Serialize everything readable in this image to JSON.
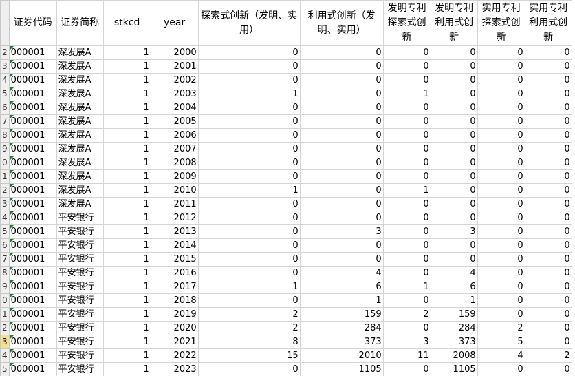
{
  "headers": [
    "证券代码",
    "证券简称",
    "stkcd",
    "year",
    "探索式创新（发明、实用）",
    "利用式创新（发明、实用）",
    "发明专利探索式创新",
    "发明专利利用式创新",
    "实用专利探索式创新",
    "实用专利利用式创新"
  ],
  "rows": [
    {
      "rn": "2",
      "cells": [
        "000001",
        "深发展A",
        "1",
        "2000",
        "0",
        "0",
        "0",
        "0",
        "0",
        "0"
      ]
    },
    {
      "rn": "3",
      "cells": [
        "000001",
        "深发展A",
        "1",
        "2001",
        "0",
        "0",
        "0",
        "0",
        "0",
        "0"
      ]
    },
    {
      "rn": "4",
      "cells": [
        "000001",
        "深发展A",
        "1",
        "2002",
        "0",
        "0",
        "0",
        "0",
        "0",
        "0"
      ]
    },
    {
      "rn": "5",
      "cells": [
        "000001",
        "深发展A",
        "1",
        "2003",
        "1",
        "0",
        "1",
        "0",
        "0",
        "0"
      ]
    },
    {
      "rn": "6",
      "cells": [
        "000001",
        "深发展A",
        "1",
        "2004",
        "0",
        "0",
        "0",
        "0",
        "0",
        "0"
      ]
    },
    {
      "rn": "7",
      "cells": [
        "000001",
        "深发展A",
        "1",
        "2005",
        "0",
        "0",
        "0",
        "0",
        "0",
        "0"
      ]
    },
    {
      "rn": "8",
      "cells": [
        "000001",
        "深发展A",
        "1",
        "2006",
        "0",
        "0",
        "0",
        "0",
        "0",
        "0"
      ]
    },
    {
      "rn": "9",
      "cells": [
        "000001",
        "深发展A",
        "1",
        "2007",
        "0",
        "0",
        "0",
        "0",
        "0",
        "0"
      ]
    },
    {
      "rn": "0",
      "cells": [
        "000001",
        "深发展A",
        "1",
        "2008",
        "0",
        "0",
        "0",
        "0",
        "0",
        "0"
      ]
    },
    {
      "rn": "1",
      "cells": [
        "000001",
        "深发展A",
        "1",
        "2009",
        "0",
        "0",
        "0",
        "0",
        "0",
        "0"
      ]
    },
    {
      "rn": "2",
      "cells": [
        "000001",
        "深发展A",
        "1",
        "2010",
        "1",
        "0",
        "1",
        "0",
        "0",
        "0"
      ]
    },
    {
      "rn": "3",
      "cells": [
        "000001",
        "深发展A",
        "1",
        "2011",
        "0",
        "0",
        "0",
        "0",
        "0",
        "0"
      ]
    },
    {
      "rn": "4",
      "cells": [
        "000001",
        "平安银行",
        "1",
        "2012",
        "0",
        "0",
        "0",
        "0",
        "0",
        "0"
      ]
    },
    {
      "rn": "5",
      "cells": [
        "000001",
        "平安银行",
        "1",
        "2013",
        "0",
        "3",
        "0",
        "3",
        "0",
        "0"
      ]
    },
    {
      "rn": "6",
      "cells": [
        "000001",
        "平安银行",
        "1",
        "2014",
        "0",
        "0",
        "0",
        "0",
        "0",
        "0"
      ]
    },
    {
      "rn": "7",
      "cells": [
        "000001",
        "平安银行",
        "1",
        "2015",
        "0",
        "0",
        "0",
        "0",
        "0",
        "0"
      ]
    },
    {
      "rn": "8",
      "cells": [
        "000001",
        "平安银行",
        "1",
        "2016",
        "0",
        "4",
        "0",
        "4",
        "0",
        "0"
      ]
    },
    {
      "rn": "9",
      "cells": [
        "000001",
        "平安银行",
        "1",
        "2017",
        "1",
        "6",
        "1",
        "6",
        "0",
        "0"
      ]
    },
    {
      "rn": "0",
      "cells": [
        "000001",
        "平安银行",
        "1",
        "2018",
        "0",
        "1",
        "0",
        "1",
        "0",
        "0"
      ]
    },
    {
      "rn": "1",
      "cells": [
        "000001",
        "平安银行",
        "1",
        "2019",
        "2",
        "159",
        "2",
        "159",
        "0",
        "0"
      ]
    },
    {
      "rn": "2",
      "cells": [
        "000001",
        "平安银行",
        "1",
        "2020",
        "2",
        "284",
        "0",
        "284",
        "2",
        "0"
      ]
    },
    {
      "rn": "3",
      "cells": [
        "000001",
        "平安银行",
        "1",
        "2021",
        "8",
        "373",
        "3",
        "373",
        "5",
        "0"
      ]
    },
    {
      "rn": "4",
      "cells": [
        "000001",
        "平安银行",
        "1",
        "2022",
        "15",
        "2010",
        "11",
        "2008",
        "4",
        "2"
      ]
    },
    {
      "rn": "5",
      "cells": [
        "000001",
        "平安银行",
        "1",
        "2023",
        "0",
        "1105",
        "0",
        "1105",
        "0",
        "0"
      ]
    }
  ]
}
